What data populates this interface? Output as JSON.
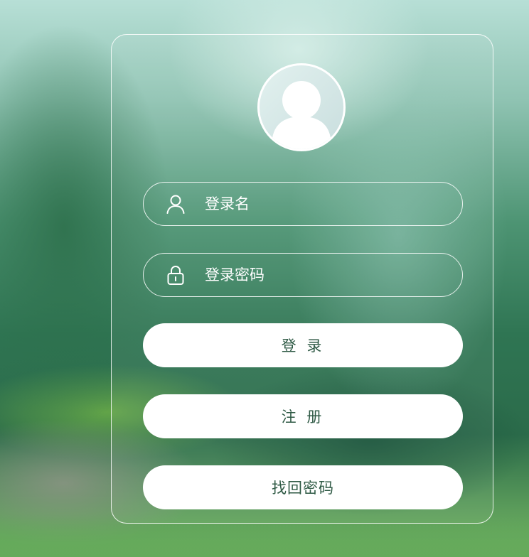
{
  "login_form": {
    "username": {
      "placeholder": "登录名",
      "value": ""
    },
    "password": {
      "placeholder": "登录密码",
      "value": ""
    },
    "login_label": "登 录",
    "register_label": "注 册",
    "forgot_label": "找回密码"
  },
  "icons": {
    "avatar": "user-avatar-icon",
    "username": "user-icon",
    "password": "lock-icon"
  }
}
